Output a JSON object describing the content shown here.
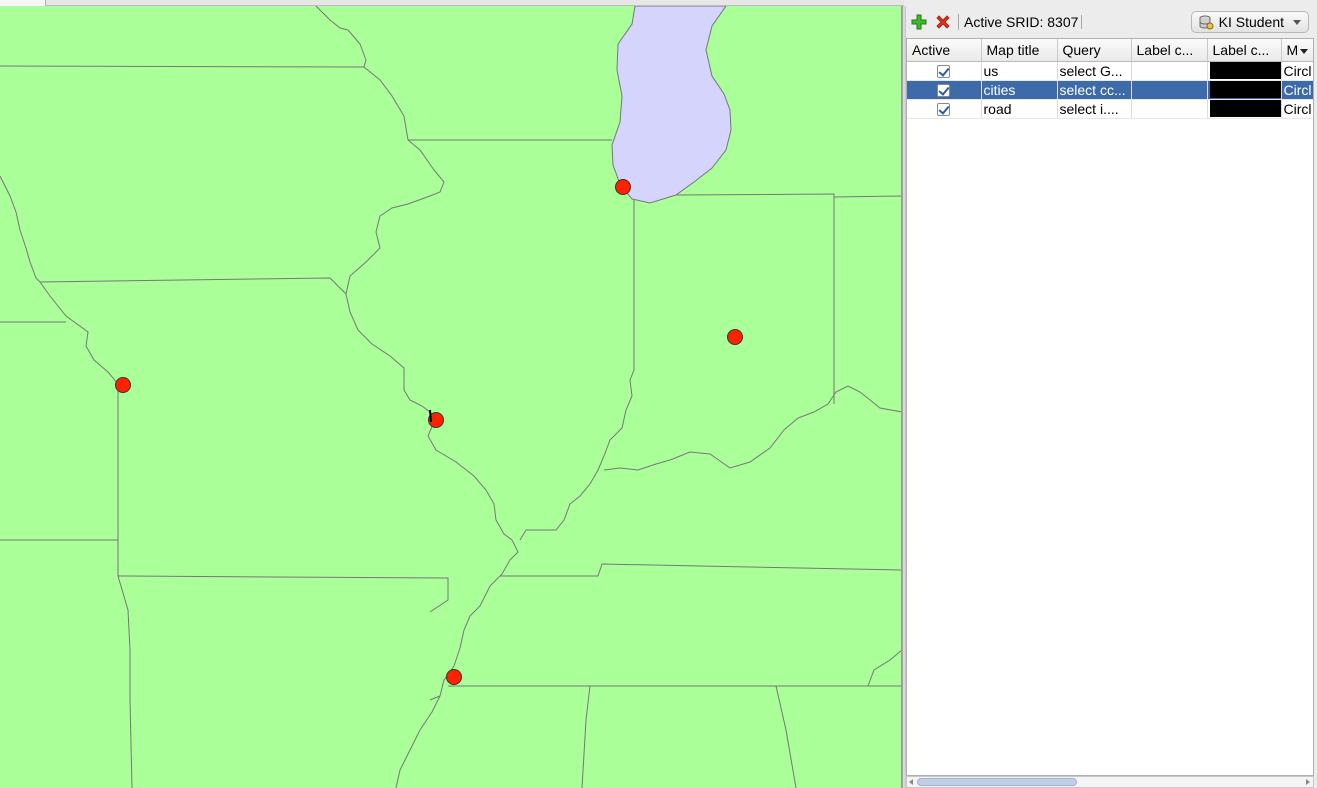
{
  "toolbar": {
    "add_icon": "plus-icon",
    "remove_icon": "x-icon",
    "srid_label": "Active SRID: 8307",
    "connection_label": "KI Student",
    "connection_icon": "database-icon"
  },
  "layer_table": {
    "columns": [
      "Active",
      "Map title",
      "Query",
      "Label c...",
      "Label c...",
      "M"
    ],
    "rows": [
      {
        "active": true,
        "map_title": "us",
        "query": "select G...",
        "label_col": "",
        "label_color": "#000000",
        "marker": "Circl",
        "selected": false
      },
      {
        "active": true,
        "map_title": "cities",
        "query": "select cc...",
        "label_col": "",
        "label_color": "#000000",
        "marker": "Circl",
        "selected": true
      },
      {
        "active": true,
        "map_title": "road",
        "query": "select i....",
        "label_col": "",
        "label_color": "#000000",
        "marker": "Circl",
        "selected": false
      }
    ]
  },
  "map": {
    "land_color": "#aaff99",
    "water_color": "#d4d4fc",
    "border_color": "#777777",
    "city_marker_color": "#ff2200"
  },
  "colors": {
    "selection": "#3d6aa8"
  }
}
